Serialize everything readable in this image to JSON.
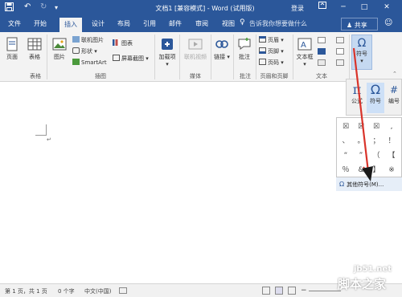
{
  "titlebar": {
    "title": "文档1 [兼容模式] - Word (试用版)",
    "login": "登录",
    "save_icon": "save-icon",
    "undo_icon": "undo-icon",
    "redo_icon": "redo-icon",
    "customize_icon": "customize-icon",
    "restore_icon": "ribbon-display-icon",
    "minimize": "─",
    "maximize": "□",
    "close": "✕"
  },
  "tabs": [
    "文件",
    "开始",
    "插入",
    "设计",
    "布局",
    "引用",
    "邮件",
    "审阅",
    "视图"
  ],
  "active_tab": "插入",
  "tellme": "告诉我你想要做什么",
  "share": "共享",
  "ribbon": {
    "pages": "页面",
    "table": "表格",
    "picture": "图片",
    "online_picture": "联机图片",
    "shapes": "形状",
    "smartart": "SmartArt",
    "chart": "图表",
    "screenshot": "屏幕截图",
    "addins": "加载项",
    "online_video": "联机视频",
    "link": "链接",
    "comment": "批注",
    "header": "页眉",
    "footer": "页脚",
    "page_number": "页码",
    "textbox": "文本框",
    "symbol": "符号",
    "groups": {
      "table": "表格",
      "illustrations": "插图",
      "media": "媒体",
      "comments": "批注",
      "header_footer": "页眉和页脚",
      "text": "文本"
    }
  },
  "symbol_dropdown": {
    "equation": "公式",
    "symbol": "符号",
    "number": "编号",
    "cells": [
      "☒",
      "☒",
      "☒",
      ",",
      "、",
      "。",
      "；",
      "！",
      "“",
      "”",
      "（",
      "【",
      "％",
      "&",
      "】",
      "※"
    ],
    "more_symbols": "其他符号(M)..."
  },
  "statusbar": {
    "pages": "第 1 页，共 1 页",
    "words": "0 个字",
    "language": "中文(中国)"
  },
  "watermark": {
    "site": "jb51.net",
    "name": "脚本之家"
  },
  "colors": {
    "titlebar": "#2b579a",
    "ribbon": "#f3f3f3",
    "accent_arrow": "#d9332a"
  }
}
